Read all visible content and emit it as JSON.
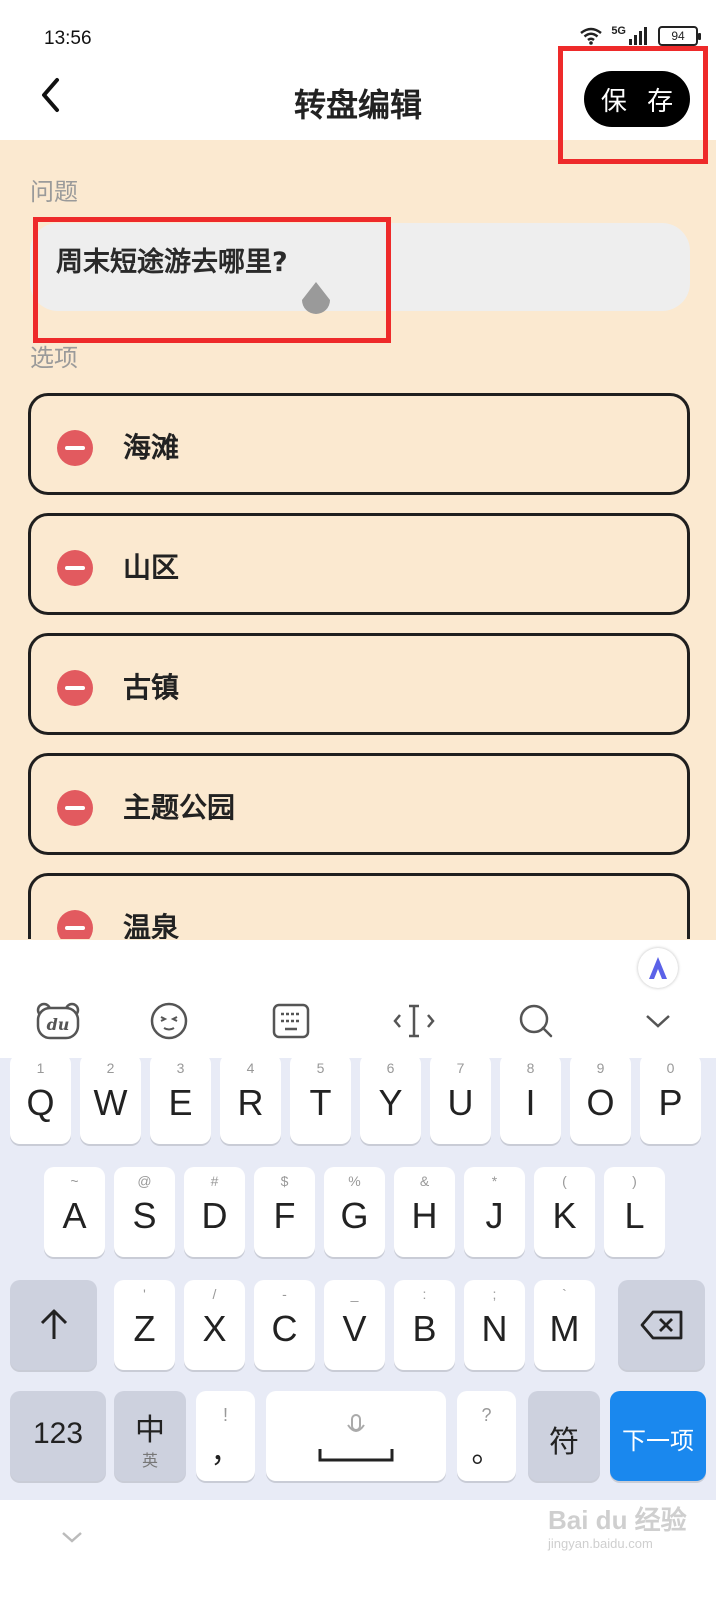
{
  "status_bar": {
    "time": "13:56",
    "network": "5G",
    "battery": "94"
  },
  "header": {
    "title": "转盘编辑",
    "save_label": "保 存"
  },
  "form": {
    "question_label": "问题",
    "question_value": "周末短途游去哪里?",
    "options_label": "选项",
    "options": [
      {
        "label": "海滩"
      },
      {
        "label": "山区"
      },
      {
        "label": "古镇"
      },
      {
        "label": "主题公园"
      },
      {
        "label": "温泉"
      }
    ]
  },
  "keyboard": {
    "toolbar_icons": [
      "bear-du-icon",
      "emoji-icon",
      "keyboard-layout-icon",
      "cursor-icon",
      "search-icon",
      "collapse-icon"
    ],
    "row1": [
      {
        "letter": "Q",
        "hint": "1"
      },
      {
        "letter": "W",
        "hint": "2"
      },
      {
        "letter": "E",
        "hint": "3"
      },
      {
        "letter": "R",
        "hint": "4"
      },
      {
        "letter": "T",
        "hint": "5"
      },
      {
        "letter": "Y",
        "hint": "6"
      },
      {
        "letter": "U",
        "hint": "7"
      },
      {
        "letter": "I",
        "hint": "8"
      },
      {
        "letter": "O",
        "hint": "9"
      },
      {
        "letter": "P",
        "hint": "0"
      }
    ],
    "row2": [
      {
        "letter": "A",
        "hint": "~"
      },
      {
        "letter": "S",
        "hint": "@"
      },
      {
        "letter": "D",
        "hint": "#"
      },
      {
        "letter": "F",
        "hint": "$"
      },
      {
        "letter": "G",
        "hint": "%"
      },
      {
        "letter": "H",
        "hint": "&"
      },
      {
        "letter": "J",
        "hint": "*"
      },
      {
        "letter": "K",
        "hint": "("
      },
      {
        "letter": "L",
        "hint": ")"
      }
    ],
    "row3": [
      {
        "letter": "Z",
        "hint": "'"
      },
      {
        "letter": "X",
        "hint": "/"
      },
      {
        "letter": "C",
        "hint": "-"
      },
      {
        "letter": "V",
        "hint": "_"
      },
      {
        "letter": "B",
        "hint": ":"
      },
      {
        "letter": "N",
        "hint": ";"
      },
      {
        "letter": "M",
        "hint": "`"
      }
    ],
    "numbers_label": "123",
    "lang_label": "中",
    "lang_sub": "英",
    "comma_hint": "!",
    "comma_label": "，",
    "period_hint": "?",
    "period_label": "。",
    "symbols_label": "符",
    "next_label": "下一项"
  },
  "watermark": {
    "text": "Bai du 经验",
    "sub": "jingyan.baidu.com"
  },
  "colors": {
    "background": "#fbe9d0",
    "highlight": "#ee2a2a",
    "remove": "#e25a5f",
    "next_key": "#1a88ee"
  }
}
